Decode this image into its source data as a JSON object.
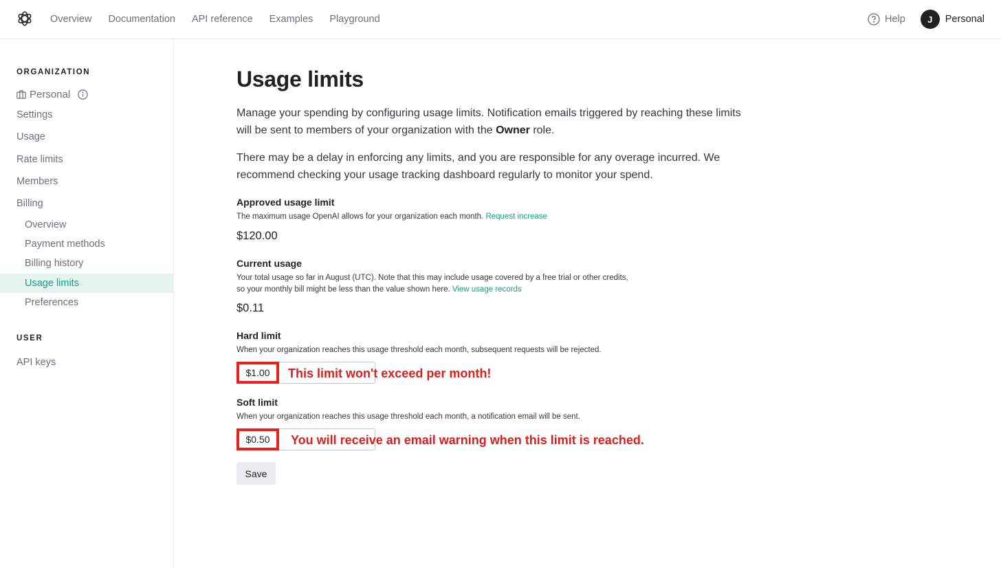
{
  "nav": {
    "links": [
      "Overview",
      "Documentation",
      "API reference",
      "Examples",
      "Playground"
    ],
    "help_label": "Help",
    "avatar_initial": "J",
    "account_name": "Personal"
  },
  "sidebar": {
    "org_heading": "ORGANIZATION",
    "org_name": "Personal",
    "items": [
      "Settings",
      "Usage",
      "Rate limits",
      "Members",
      "Billing"
    ],
    "billing_items": [
      "Overview",
      "Payment methods",
      "Billing history",
      "Usage limits",
      "Preferences"
    ],
    "active_item": "Usage limits",
    "user_heading": "USER",
    "user_items": [
      "API keys"
    ],
    "accent_color": "#10a37f"
  },
  "main": {
    "title": "Usage limits",
    "intro_1_pre": "Manage your spending by configuring usage limits. Notification emails triggered by reaching these limits will be sent to members of your organization with the ",
    "intro_1_bold": "Owner",
    "intro_1_post": " role.",
    "intro_2": "There may be a delay in enforcing any limits, and you are responsible for any overage incurred. We recommend checking your usage tracking dashboard regularly to monitor your spend.",
    "approved": {
      "label": "Approved usage limit",
      "desc": "The maximum usage OpenAI allows for your organization each month.",
      "link": "Request increase",
      "value": "$120.00"
    },
    "current": {
      "label": "Current usage",
      "desc": "Your total usage so far in August (UTC). Note that this may include usage covered by a free trial or other credits, so your monthly bill might be less than the value shown here.",
      "link": "View usage records",
      "value": "$0.11"
    },
    "hard_limit": {
      "label": "Hard limit",
      "desc": "When your organization reaches this usage threshold each month, subsequent requests will be rejected.",
      "value": "$1.00",
      "annotation": "This limit won't exceed per month!"
    },
    "soft_limit": {
      "label": "Soft limit",
      "desc": "When your organization reaches this usage threshold each month, a notification email will be sent.",
      "value": "$0.50",
      "annotation": "You will receive an email warning when this limit is reached."
    },
    "save_label": "Save",
    "annotation_color": "#d8201e"
  }
}
